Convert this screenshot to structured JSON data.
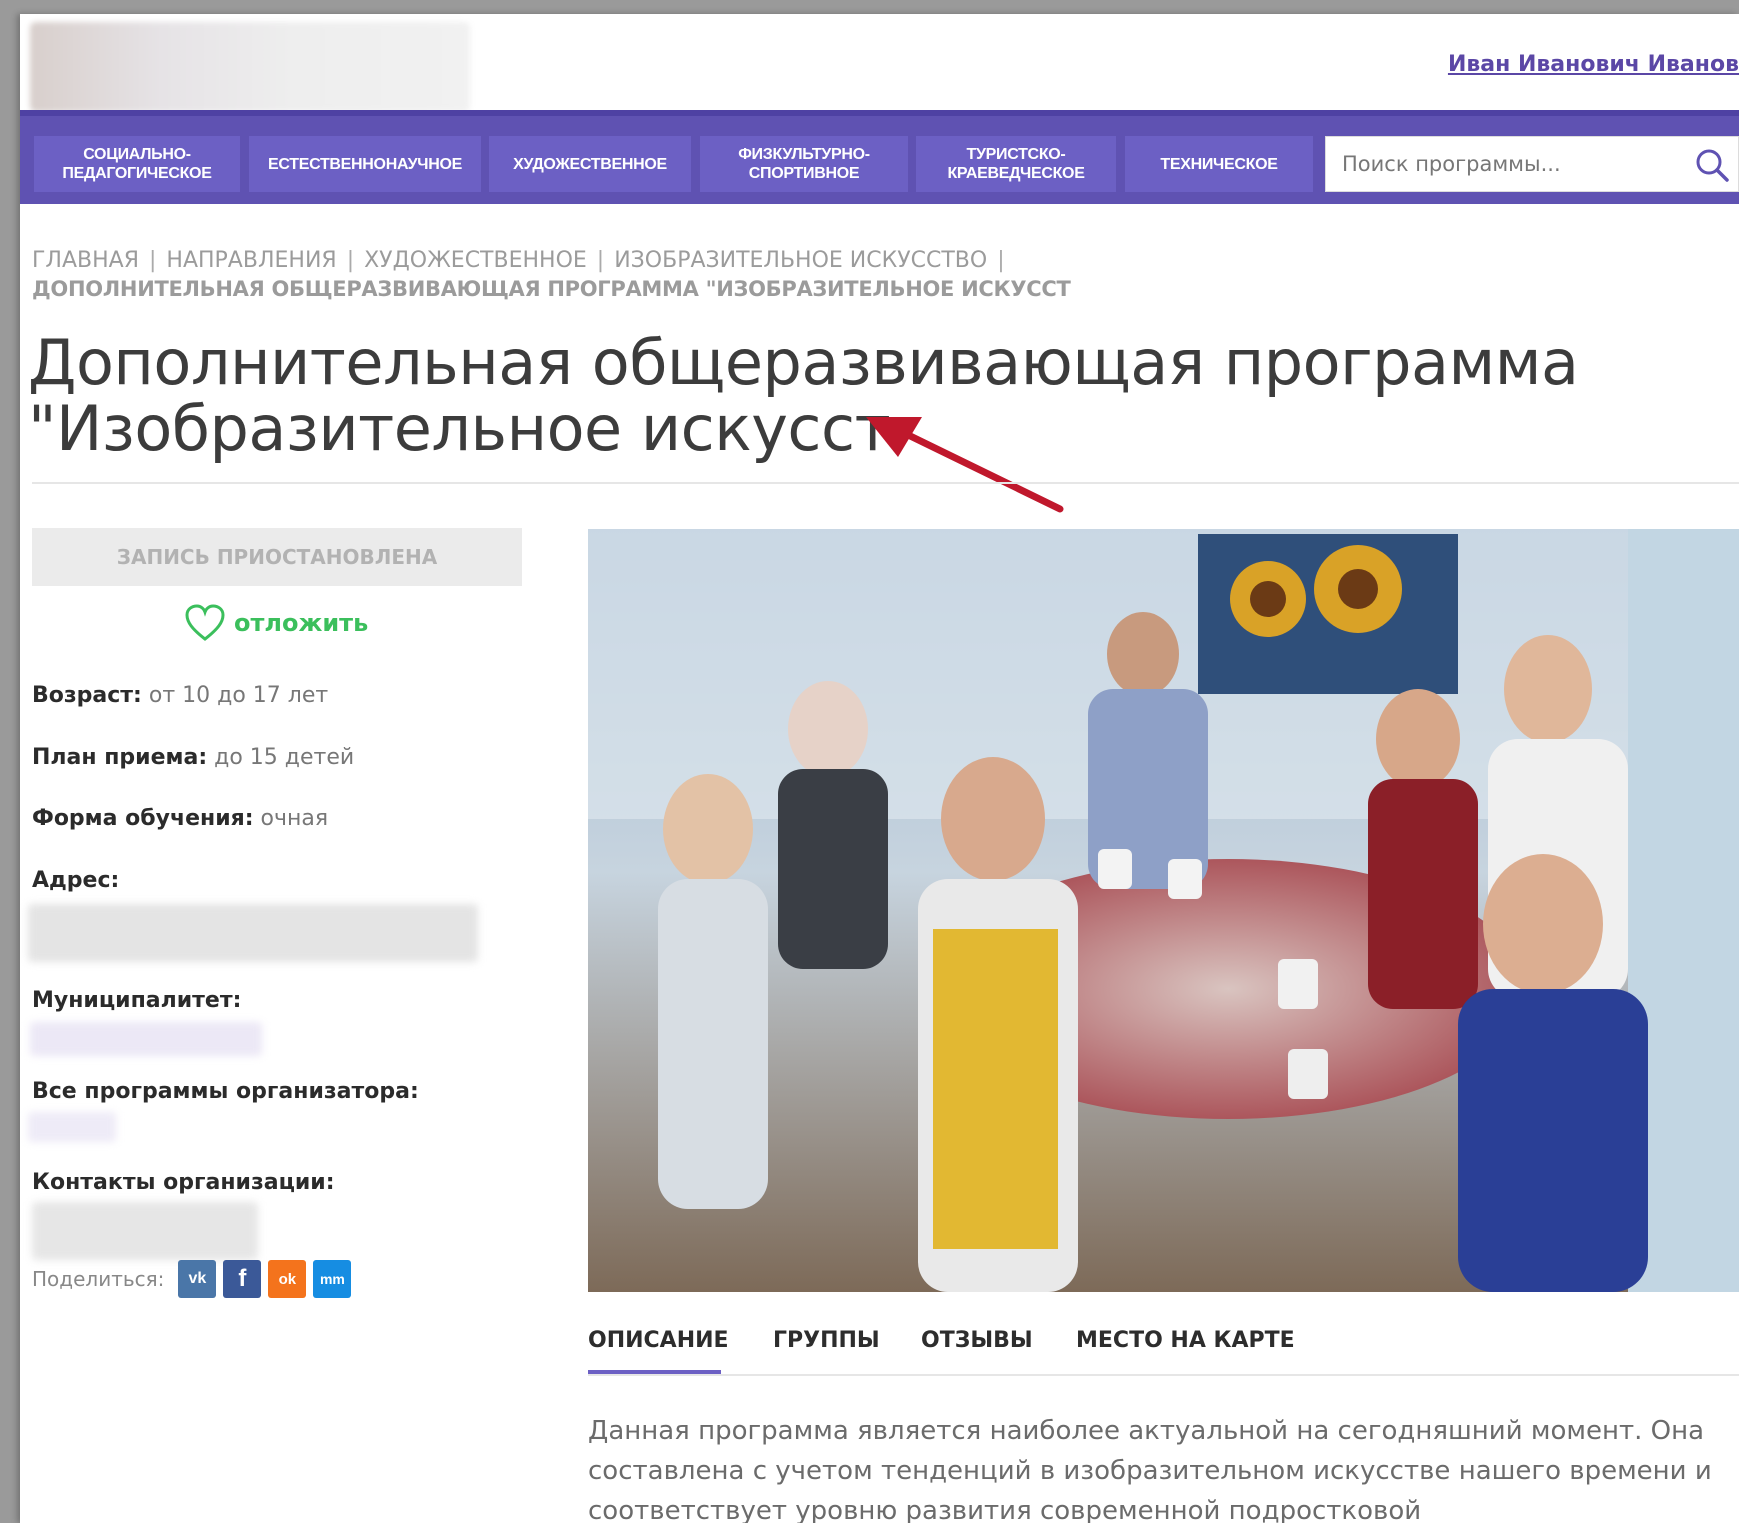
{
  "header": {
    "user_name": "Иван Иванович Иванов"
  },
  "nav": {
    "items": [
      {
        "label": "Социально-педагогическое"
      },
      {
        "label": "Естественнонаучное"
      },
      {
        "label": "Художественное"
      },
      {
        "label": "Физкультурно-спортивное"
      },
      {
        "label": "Туристско-краеведческое"
      },
      {
        "label": "Техническое"
      }
    ],
    "search_placeholder": "Поиск программы...",
    "search_icon": "search-icon"
  },
  "breadcrumb": {
    "items": [
      "Главная",
      "Направления",
      "Художественное",
      "Изобразительное искусство"
    ],
    "separator": "|",
    "current": "Дополнительная общеразвивающая программа \"Изобразительное искусст"
  },
  "page": {
    "title_line1": "Дополнительная общеразвивающая программа",
    "title_line2": "\"Изобразительное искусст"
  },
  "sidebar": {
    "signup_status": "Запись приостановлена",
    "save_label": "отложить",
    "age_label": "Возраст:",
    "age_value": "от 10 до 17 лет",
    "plan_label": "План приема:",
    "plan_value": "до 15 детей",
    "form_label": "Форма обучения:",
    "form_value": "очная",
    "address_label": "Адрес:",
    "municipality_label": "Муниципалитет:",
    "all_programs_label": "Все программы организатора:",
    "contacts_label": "Контакты организации:",
    "share_label": "Поделиться:",
    "share_buttons": [
      {
        "name": "vk",
        "glyph": "vk",
        "color": "#4a76a8"
      },
      {
        "name": "facebook",
        "glyph": "f",
        "color": "#3b5998"
      },
      {
        "name": "odnoklassniki",
        "glyph": "ok",
        "color": "#f4731c"
      },
      {
        "name": "moimir",
        "glyph": "mm",
        "color": "#168de2"
      }
    ]
  },
  "tabs": [
    {
      "label": "Описание",
      "active": true
    },
    {
      "label": "Группы",
      "active": false
    },
    {
      "label": "Отзывы",
      "active": false
    },
    {
      "label": "Место на карте",
      "active": false
    }
  ],
  "description": "Данная программа является наиболее актуальной на сегодняшний момент. Она составлена с учетом тенденций в изобразительном искусстве нашего времени и соответствует уровню развития современной подростковой",
  "colors": {
    "nav_bg": "#5f52b2",
    "nav_item_bg": "#6c60c4",
    "link": "#5b47a6",
    "save_green": "#3bbf5c",
    "arrow": "#c0182c"
  }
}
